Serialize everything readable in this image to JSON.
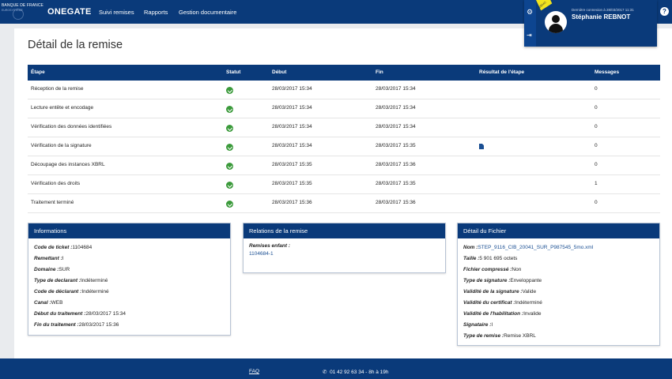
{
  "navbar": {
    "logo_line1": "BANQUE DE FRANCE",
    "logo_line2": "EUROSYSTÈME",
    "brand": "ONEGATE",
    "items": [
      "Suivi remises",
      "Rapports",
      "Gestion documentaire"
    ],
    "help": "?"
  },
  "user": {
    "last_login": "Dernière connexion à 28/03/2017 11:31",
    "name": "Stéphanie REBNOT",
    "ribbon": "DEMO"
  },
  "page": {
    "title": "Détail de la remise"
  },
  "table": {
    "headers": [
      "Étape",
      "Statut",
      "Début",
      "Fin",
      "Résultat de l'étape",
      "Messages"
    ],
    "rows": [
      {
        "step": "Réception de la remise",
        "status": "ok",
        "start": "28/03/2017 15:34",
        "end": "28/03/2017 15:34",
        "result": "",
        "messages": "0"
      },
      {
        "step": "Lecture entête et encodage",
        "status": "ok",
        "start": "28/03/2017 15:34",
        "end": "28/03/2017 15:34",
        "result": "",
        "messages": "0"
      },
      {
        "step": "Vérification des données identifiées",
        "status": "ok",
        "start": "28/03/2017 15:34",
        "end": "28/03/2017 15:34",
        "result": "",
        "messages": "0"
      },
      {
        "step": "Vérification de la signature",
        "status": "ok",
        "start": "28/03/2017 15:34",
        "end": "28/03/2017 15:35",
        "result": "file-icon",
        "messages": "0"
      },
      {
        "step": "Découpage des instances XBRL",
        "status": "ok",
        "start": "28/03/2017 15:35",
        "end": "28/03/2017 15:36",
        "result": "",
        "messages": "0"
      },
      {
        "step": "Vérification des droits",
        "status": "ok",
        "start": "28/03/2017 15:35",
        "end": "28/03/2017 15:35",
        "result": "",
        "messages": "1"
      },
      {
        "step": "Traitement terminé",
        "status": "ok",
        "start": "28/03/2017 15:36",
        "end": "28/03/2017 15:36",
        "result": "",
        "messages": "0"
      }
    ]
  },
  "informations": {
    "title": "Informations",
    "fields": [
      {
        "label": "Code de ticket :",
        "value": "1104684"
      },
      {
        "label": "Remettant :",
        "value": "I"
      },
      {
        "label": "Domaine :",
        "value": "SUR"
      },
      {
        "label": "Type de declarant :",
        "value": "Indéterminé"
      },
      {
        "label": "Code de déclarant :",
        "value": "Indéterminé"
      },
      {
        "label": "Canal :",
        "value": "WEB"
      },
      {
        "label": "Début du traitement :",
        "value": "28/03/2017 15:34"
      },
      {
        "label": "Fin du traitement :",
        "value": "28/03/2017 15:36"
      }
    ]
  },
  "relations": {
    "title": "Relations de la remise",
    "label": "Remises enfant :",
    "child": "1104684-1"
  },
  "fichier": {
    "title": "Détail du Fichier",
    "fields": [
      {
        "label": "Nom :",
        "value": "STEP_9116_CIB_20041_SUR_P987545_5mo.xml"
      },
      {
        "label": "Taille :",
        "value": "5 901 695 octets"
      },
      {
        "label": "Fichier compressé :",
        "value": "Non"
      },
      {
        "label": "Type de signature :",
        "value": "Enveloppante"
      },
      {
        "label": "Validité de la signature :",
        "value": "Valide"
      },
      {
        "label": "Validité du certificat :",
        "value": "Indéterminé"
      },
      {
        "label": "Validité de l'habilitation :",
        "value": "Invalide"
      },
      {
        "label": "Signataire :",
        "value": "I"
      },
      {
        "label": "Type de remise :",
        "value": "Remise XBRL"
      }
    ]
  },
  "footer": {
    "faq": "FAQ",
    "phone": "01 42 92 63 34 - 8h à 19h"
  },
  "colors": {
    "primary": "#0a3a7a",
    "success": "#3a9a3a",
    "link": "#1a4f93",
    "ribbon": "#f2e41e"
  }
}
